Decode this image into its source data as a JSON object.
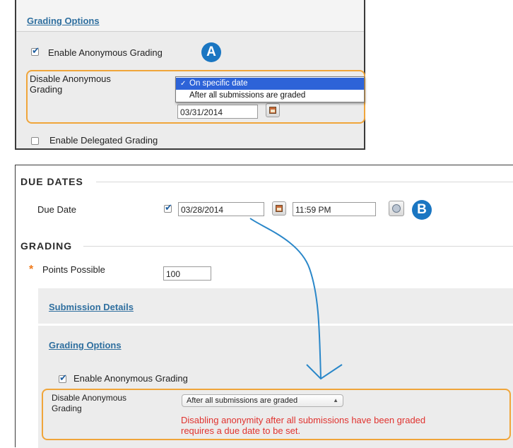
{
  "top_panel": {
    "header_link": "Grading Options",
    "anon_checkbox_label": "Enable Anonymous Grading",
    "callout_a": "A",
    "disable_label_line1": "Disable Anonymous",
    "disable_label_line2": "Grading",
    "dropdown_options": [
      {
        "label": "On specific date",
        "selected": true
      },
      {
        "label": "After all submissions are graded",
        "selected": false
      }
    ],
    "date_value": "03/31/2014",
    "delegated_label": "Enable Delegated Grading"
  },
  "bottom_panel": {
    "due_dates_heading": "DUE DATES",
    "due_date_label": "Due Date",
    "due_date_value": "03/28/2014",
    "due_time_value": "11:59 PM",
    "callout_b": "B",
    "grading_heading": "GRADING",
    "required_marker": "*",
    "points_label": "Points Possible",
    "points_value": "100",
    "submission_details_link": "Submission Details",
    "grading_options_link": "Grading Options",
    "anon_checkbox_label": "Enable Anonymous Grading",
    "disable_label_line1": "Disable Anonymous",
    "disable_label_line2": "Grading",
    "disable_select_value": "After all submissions are graded",
    "error_line1": "Disabling anonymity after all submissions have been graded",
    "error_line2": "requires a due date to be set."
  },
  "colors": {
    "link": "#2f6f9f",
    "callout": "#1a76c2",
    "highlight_border": "#f0a53a",
    "arrow": "#2a87c9",
    "error_text": "#e0332f",
    "required_star": "#f07a1a",
    "dropdown_selected": "#2d63d8"
  },
  "icons": [
    "checkmark-icon",
    "calendar-icon",
    "clock-icon",
    "dropdown-arrow-icon",
    "curved-arrow"
  ]
}
